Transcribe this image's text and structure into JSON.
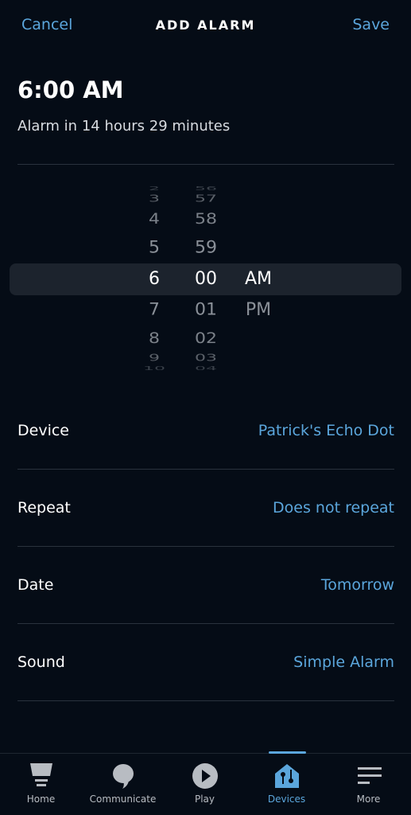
{
  "header": {
    "cancel": "Cancel",
    "title": "ADD ALARM",
    "save": "Save"
  },
  "alarm": {
    "time": "6:00 AM",
    "countdown": "Alarm in 14 hours 29 minutes"
  },
  "picker": {
    "hours": [
      "2",
      "3",
      "4",
      "5",
      "6",
      "7",
      "8",
      "9",
      "10"
    ],
    "minutes": [
      "56",
      "57",
      "58",
      "59",
      "00",
      "01",
      "02",
      "03",
      "04"
    ],
    "period": [
      "AM",
      "PM"
    ],
    "selected": {
      "hour": "6",
      "minute": "00",
      "period": "AM"
    }
  },
  "settings": [
    {
      "label": "Device",
      "value": "Patrick's Echo Dot"
    },
    {
      "label": "Repeat",
      "value": "Does not repeat"
    },
    {
      "label": "Date",
      "value": "Tomorrow"
    },
    {
      "label": "Sound",
      "value": "Simple Alarm"
    }
  ],
  "nav": {
    "items": [
      {
        "label": "Home",
        "icon": "home-icon"
      },
      {
        "label": "Communicate",
        "icon": "chat-bubble-icon"
      },
      {
        "label": "Play",
        "icon": "play-icon"
      },
      {
        "label": "Devices",
        "icon": "devices-house-icon",
        "active": true
      },
      {
        "label": "More",
        "icon": "menu-icon"
      }
    ]
  },
  "colors": {
    "accent": "#5ba6dc",
    "background": "#050c16"
  }
}
